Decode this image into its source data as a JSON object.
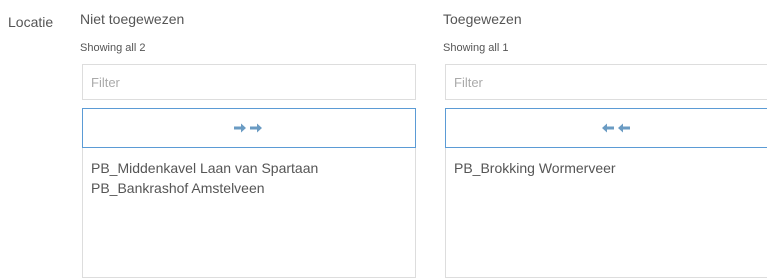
{
  "field": {
    "label": "Locatie"
  },
  "available": {
    "title": "Niet toegewezen",
    "info": "Showing all 2",
    "filter_placeholder": "Filter",
    "move_icon": "double-arrow-right-icon",
    "items": [
      {
        "label": "PB_Middenkavel Laan van Spartaan"
      },
      {
        "label": "PB_Bankrashof Amstelveen"
      }
    ]
  },
  "selected": {
    "title": "Toegewezen",
    "info": "Showing all 1",
    "filter_placeholder": "Filter",
    "move_icon": "double-arrow-left-icon",
    "items": [
      {
        "label": "PB_Brokking Wormerveer"
      }
    ]
  },
  "colors": {
    "accent": "#5b9bd5",
    "arrow": "#6a9bc3",
    "border": "#dddddd",
    "text": "#555555"
  }
}
